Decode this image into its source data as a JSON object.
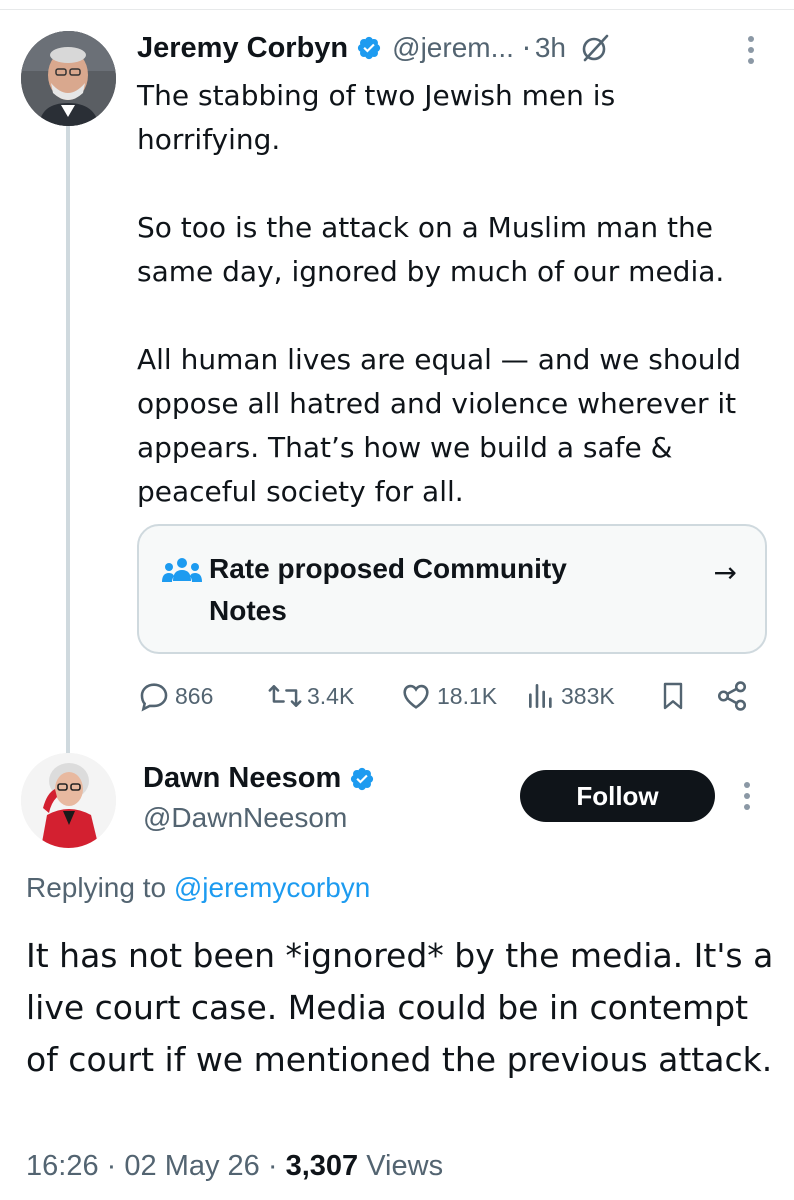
{
  "tweet1": {
    "author": "Jeremy Corbyn",
    "handle": "@jerem...",
    "separator": "·",
    "time": "3h",
    "paragraphs": [
      "The stabbing of two Jewish men is horrifying.",
      "So too is the attack on a Muslim man the same day, ignored by much of our media.",
      "All human lives are equal — and we should oppose all hatred and violence wherever it appears. That’s how we build a safe & peaceful society for all."
    ],
    "community_notes": {
      "label": "Rate proposed Community Notes",
      "arrow": "→"
    },
    "stats": {
      "replies": "866",
      "reposts": "3.4K",
      "likes": "18.1K",
      "views": "383K"
    }
  },
  "tweet2": {
    "author": "Dawn Neesom",
    "handle": "@DawnNeesom",
    "follow_label": "Follow",
    "replying_prefix": "Replying to",
    "replying_to": "@jeremycorbyn",
    "body": "It has not been *ignored* by the media. It's a live court case. Media could be in contempt of court if we mentioned the previous attack.",
    "time": "16:26",
    "date": "02 May 26",
    "sep": "·",
    "views_count": "3,307",
    "views_label": "Views"
  },
  "colors": {
    "verified": "#1d9bf0",
    "link": "#1d9bf0",
    "secondary_text": "#536471",
    "primary_text": "#0f1419",
    "thread_line": "#cfd9de"
  },
  "icons": [
    "verified-badge-icon",
    "grok-icon",
    "more-icon",
    "community-notes-icon",
    "reply-icon",
    "repost-icon",
    "like-icon",
    "views-icon",
    "bookmark-icon",
    "share-icon"
  ]
}
